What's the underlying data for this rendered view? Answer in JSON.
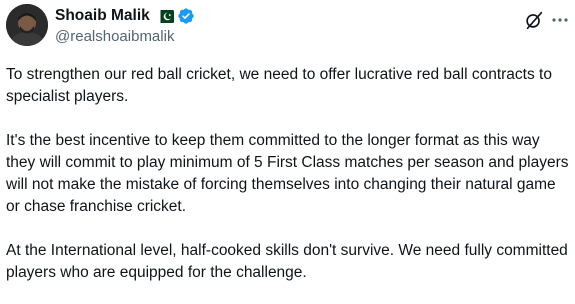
{
  "author": {
    "display_name": "Shoaib Malik",
    "handle": "@realshoaibmalik",
    "verified": true,
    "flag": "pakistan-flag"
  },
  "actions": {
    "grok_icon": "grok-icon",
    "more_icon": "more-icon"
  },
  "tweet": {
    "paragraphs": [
      "To strengthen our red ball cricket, we need to offer lucrative red ball contracts to specialist players.",
      "It's the best incentive to keep them committed to the longer format as this way they will commit to play minimum of 5 First Class matches per season and players will not make the mistake of forcing themselves into changing their natural game or chase franchise cricket.",
      "At the International level, half-cooked skills don't survive. We need fully committed players who are equipped for the challenge."
    ]
  },
  "colors": {
    "text": "#0f1419",
    "secondary": "#536471",
    "verified_blue": "#1d9bf0",
    "flag_green": "#01411c"
  }
}
